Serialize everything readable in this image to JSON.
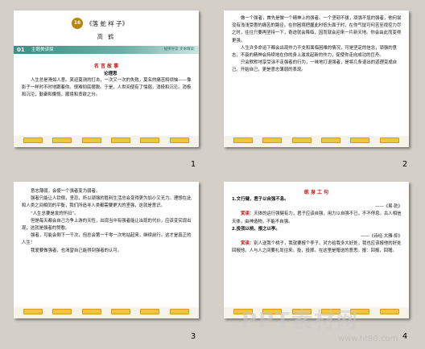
{
  "slides": [
    {
      "number": "1",
      "badge": "16",
      "title": "《落 蛇 样 子》",
      "author": "高  鹤",
      "section_tag": "01",
      "section_label": "主题美读探",
      "right_tag": "规律导读 文本精读",
      "heading": "名 言 故 事",
      "subheading": "论理思",
      "paragraphs": [
        "人生总是滑如人意。笑迎莫测的打击，一次又一次的失败，莫名的痛苦和烦恼——像影子一样时不时地跟着你。很难彻底摆脱。于是，人世间便有了懦弱，消极和沉沦。消极和沉沦，勤奋和懒惰，顺境和贪欲之分。"
      ]
    },
    {
      "number": "2",
      "paragraphs": [
        "做一个强者，首先是做一个精神上的强者。一个坚韧不拔，顽强不屈的强者，他何尝没有浅浅受惠的痛苦的路径。在你困境把握此时低头面子时，在你气馁可何苦至视控力尽之时，往往只要再坚持一下，奇迹就会降临，因而就会迎来一片新天地。你会由此而变得更强。",
        "人生许多命运下都会出现作力不支和面临困难的情况，可是坚定的信念，顽强的意志，不衰的精神会持续地在你的身上激发起新的作力，促使你走向成功的巨舟。",
        "只会默默地享受涂不走强者的行为，一味地打退强者，是将几条退出的道理变成自己。开始自己，更是意志薄弱的表现。"
      ]
    },
    {
      "number": "3",
      "paragraphs": [
        "意志薄弱，会使一个强者变为弱者。",
        "强者只能让人钦佩，坚忍，所以顽强的胜利生活总会变得更为加小又无力。理想在此和人类之间相同的平衡，我们所追寻人类都需要更大的坚强，这就是意识。",
        "“人生总要是发的怀旧”。",
        "但是每天都会自己力争上游的天性，出现当中有强者能让出现的代价，应该变实现出现，这就是强者的赞歌。",
        "强者，可能会倒下一千次，但总会第一千零一次地站起来，继续前行。这才是真正的人生！",
        "我爱要做强者，也渴望自己能得到强者的认可。"
      ]
    },
    {
      "number": "4",
      "heading": "练 身 工 句",
      "lines": [
        {
          "text": "1.文行健，君子以自强不息。",
          "cls": ""
        },
        {
          "text": "——《易·乾》",
          "cls": "right"
        },
        {
          "label": "赏读：",
          "text": "天体的运行强健有力，君子应该自强，用力以自强不已，不不停息。古人相信天体，由神造物，不能不自强。"
        },
        {
          "text": "2.投我以桃，报之以李。",
          "cls": ""
        },
        {
          "text": "——《诗经·大雅·抑》",
          "cls": "right"
        },
        {
          "label": "赏读：",
          "text": "别人送我个桃子，我就要报个李子。对方给我多大好处，我也应该报他的好处回报他。人与人之间要礼尚往来。投，投掷。在这里是赠送的意思。报：回报，回赠。"
        }
      ]
    }
  ],
  "watermark": "PPT素材网",
  "watermark_url": "www.ht88.com",
  "colors": {
    "accent_red": "#d01010",
    "band_teal": "#3d8f87",
    "badge_gold": "#b8860b",
    "button_gold": "#f2c53a"
  }
}
